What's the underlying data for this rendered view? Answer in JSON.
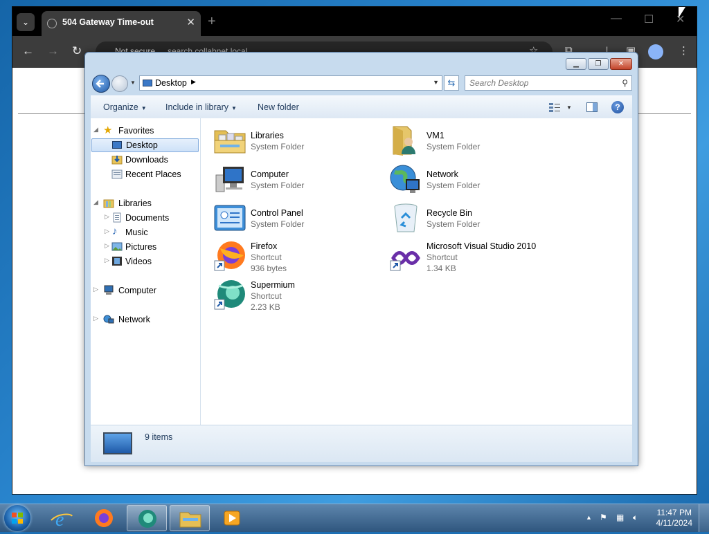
{
  "browser": {
    "tab_title": "504 Gateway Time-out",
    "not_secure": "Not secure",
    "url": "search.collabnet.local"
  },
  "explorer": {
    "address": {
      "crumb": "Desktop"
    },
    "search": {
      "placeholder": "Search Desktop"
    },
    "commands": {
      "organize": "Organize",
      "include_in_library": "Include in library",
      "new_folder": "New folder"
    },
    "nav": {
      "favorites": "Favorites",
      "desktop": "Desktop",
      "downloads": "Downloads",
      "recent_places": "Recent Places",
      "libraries": "Libraries",
      "documents": "Documents",
      "music": "Music",
      "pictures": "Pictures",
      "videos": "Videos",
      "computer": "Computer",
      "network": "Network"
    },
    "items": [
      {
        "name": "Libraries",
        "type": "System Folder",
        "icon": "libraries-folder-icon"
      },
      {
        "name": "VM1",
        "type": "System Folder",
        "icon": "user-folder-icon"
      },
      {
        "name": "Computer",
        "type": "System Folder",
        "icon": "computer-icon"
      },
      {
        "name": "Network",
        "type": "System Folder",
        "icon": "network-globe-icon"
      },
      {
        "name": "Control Panel",
        "type": "System Folder",
        "icon": "control-panel-icon"
      },
      {
        "name": "Recycle Bin",
        "type": "System Folder",
        "icon": "recycle-bin-icon"
      },
      {
        "name": "Firefox",
        "type": "Shortcut",
        "size": "936 bytes",
        "icon": "firefox-icon"
      },
      {
        "name": "Microsoft Visual Studio 2010",
        "type": "Shortcut",
        "size": "1.34 KB",
        "icon": "visual-studio-icon"
      },
      {
        "name": "Supermium",
        "type": "Shortcut",
        "size": "2.23 KB",
        "icon": "supermium-icon"
      }
    ],
    "status": {
      "count": "9 items"
    }
  },
  "taskbar": {
    "time": "11:47 PM",
    "date": "4/11/2024"
  },
  "colors": {
    "accent": "#3b78c6",
    "selection": "#cde1f8",
    "taskbar": "#2f567e"
  }
}
